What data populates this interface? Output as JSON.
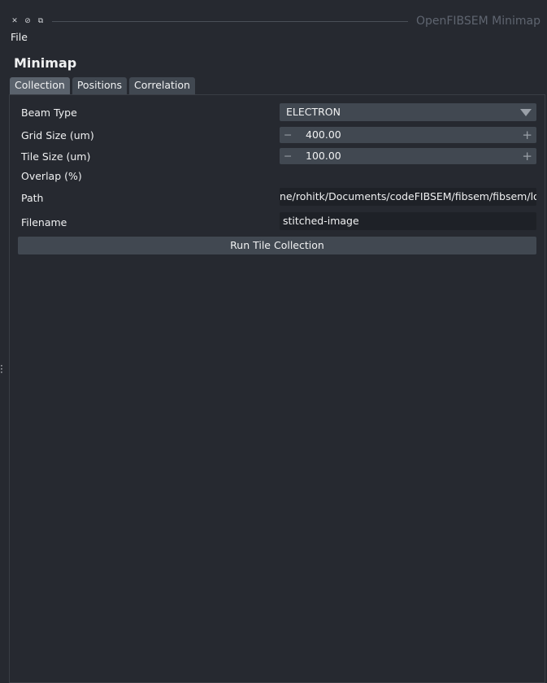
{
  "window": {
    "title": "OpenFIBSEM Minimap",
    "icons": [
      "close-icon",
      "float-icon",
      "restore-icon"
    ]
  },
  "menu": {
    "file": "File"
  },
  "heading": "Minimap",
  "tabs": [
    {
      "label": "Collection",
      "active": true
    },
    {
      "label": "Positions"
    },
    {
      "label": "Correlation"
    }
  ],
  "form": {
    "beam_type": {
      "label": "Beam Type",
      "value": "ELECTRON"
    },
    "grid_size": {
      "label": "Grid Size (um)",
      "value": "400.00"
    },
    "tile_size": {
      "label": "Tile Size (um)",
      "value": "100.00"
    },
    "overlap": {
      "label": "Overlap (%)"
    },
    "path": {
      "label": "Path",
      "value": "ne/rohitk/Documents/codeFIBSEM/fibsem/fibsem/log"
    },
    "filename": {
      "label": "Filename",
      "value": "stitched-image"
    }
  },
  "run_button": "Run Tile Collection",
  "spin": {
    "minus": "−",
    "plus": "+"
  },
  "colors": {
    "background": "#262930",
    "control": "#414851",
    "input": "#1e2127"
  }
}
